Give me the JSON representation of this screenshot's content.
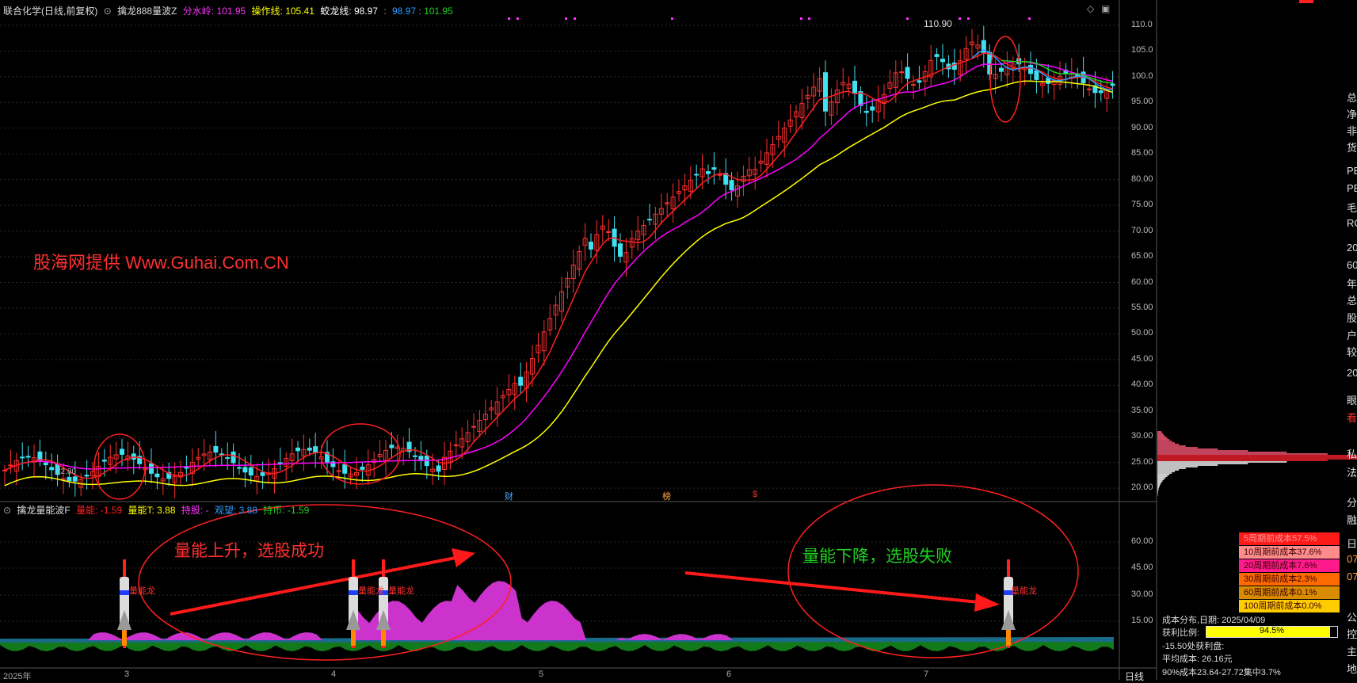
{
  "header": {
    "stock": "联合化学(日线,前复权)",
    "indicator_name": "擒龙888量波Z",
    "fen_shui_ling_label": "分水岭:",
    "fen_shui_ling_value": "101.95",
    "cao_zuo_xian_label": "操作线:",
    "cao_zuo_xian_value": "105.41",
    "jiao_long_xian_label": "蛟龙线:",
    "jiao_long_v1": "98.97",
    "jiao_long_v2": "98.97",
    "jiao_long_v3": "101.95"
  },
  "sub_header": {
    "indicator_name": "擒龙量能波F",
    "liang_neng_label": "量能:",
    "liang_neng_value": "-1.59",
    "liang_neng_t_label": "量能T:",
    "liang_neng_t_value": "3.88",
    "chi_gu_label": "持股:",
    "chi_gu_value": "-",
    "guan_wang_label": "观望:",
    "guan_wang_value": "3.88",
    "chi_bi_label": "持币:",
    "chi_bi_value": "-1.59"
  },
  "annotations": {
    "watermark": "股海网提供 Www.Guhai.Com.CN",
    "vol_up": "量能上升，选股成功",
    "vol_down": "量能下降，选股失败",
    "dragon_label": "量能龙",
    "peak_price": "110.90",
    "low_price": "22.80",
    "event_cai": "财",
    "event_bang": "榜",
    "event_s": "$"
  },
  "axis": {
    "main_ticks": [
      "110.0",
      "105.0",
      "100.0",
      "95.00",
      "90.00",
      "85.00",
      "80.00",
      "75.00",
      "70.00",
      "65.00",
      "60.00",
      "55.00",
      "50.00",
      "45.00",
      "40.00",
      "35.00",
      "30.00",
      "25.00",
      "20.00"
    ],
    "sub_ticks": [
      "60.00",
      "45.00",
      "30.00",
      "15.00"
    ],
    "dates": [
      "2025年",
      "3",
      "4",
      "5",
      "6",
      "7"
    ],
    "period": "日线"
  },
  "cost_dist": {
    "rows": [
      {
        "label": "5周期前成本57.5%",
        "bg": "#ff1a1a",
        "fg": "#ff9999"
      },
      {
        "label": "10周期前成本37.6%",
        "bg": "#ff8c8c",
        "fg": "#3a0000"
      },
      {
        "label": "20周期前成本7.6%",
        "bg": "#ff1a8c",
        "fg": "#3a0000"
      },
      {
        "label": "30周期前成本2.3%",
        "bg": "#ff6a00",
        "fg": "#3a0000"
      },
      {
        "label": "60周期前成本0.1%",
        "bg": "#d98c00",
        "fg": "#3a0000"
      },
      {
        "label": "100周期前成本0.0%",
        "bg": "#ffcc00",
        "fg": "#3a0000"
      }
    ],
    "date_line": "成本分布,日期: 2025/04/09",
    "profit_label": "获利比例:",
    "profit_value": "94.5%",
    "profit_fraction": 0.945,
    "profit_line": "-15.50处获利盘:",
    "avg_cost": "平均成本: 26.16元",
    "concentration": "90%成本23.64-27.72集中3.7%"
  },
  "right_panel_chars": [
    "总",
    "净",
    "非",
    "货",
    "PE",
    "PE",
    "毛",
    "RO",
    "20",
    "60",
    "年",
    "总",
    "股",
    "户",
    "较",
    "20",
    "眼",
    "看",
    "私",
    "法",
    "分",
    "融",
    "日",
    "07",
    "07",
    "公",
    "控",
    "主",
    "地"
  ]
}
